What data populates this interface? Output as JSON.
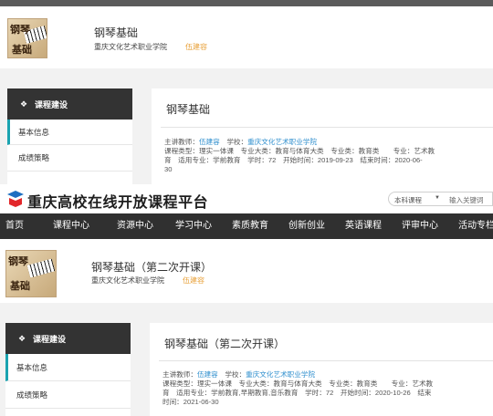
{
  "top": {
    "course_title": "钢琴基础",
    "school": "重庆文化艺术职业学院",
    "teacher": "伍建容",
    "thumb_text_1": "钢琴",
    "thumb_text_2": "基础",
    "sidebar": {
      "header": "课程建设",
      "items": [
        "基本信息",
        "成绩策略"
      ]
    },
    "panel": {
      "title": "钢琴基础",
      "teacher_label": "主讲教师：",
      "teacher": "伍建容",
      "school_label": "学校：",
      "school": "重庆文化艺术职业学院",
      "line2": "课程类型：理实一体课　专业大类：教育与体育大类　专业类：教育类　　专业：艺术教",
      "line3": "育　适用专业：学前教育　学时：72　开始时间：2019-09-23　结束时间：2020-06-",
      "line4": "30"
    }
  },
  "site": {
    "name": "重庆高校在线开放课程平台",
    "search_select": "本科课程",
    "search_placeholder": "输入关键词",
    "nav": [
      "首页",
      "课程中心",
      "资源中心",
      "学习中心",
      "素质教育",
      "创新创业",
      "英语课程",
      "评审中心",
      "活动专栏"
    ]
  },
  "bottom": {
    "course_title": "钢琴基础（第二次开课）",
    "school": "重庆文化艺术职业学院",
    "teacher": "伍建容",
    "thumb_text_1": "钢琴",
    "thumb_text_2": "基础",
    "sidebar": {
      "header": "课程建设",
      "items": [
        "基本信息",
        "成绩策略"
      ]
    },
    "panel": {
      "title": "钢琴基础（第二次开课）",
      "teacher_label": "主讲教师：",
      "teacher": "伍建容",
      "school_label": "学校：",
      "school": "重庆文化艺术职业学院",
      "line2": "课程类型：理实一体课　专业大类：教育与体育大类　专业类：教育类　　专业：艺术教",
      "line3": "育　适用专业：学前教育,早期教育,音乐教育　学时：72　开始时间：2020-10-26　结束",
      "line4": "时间：2021-06-30"
    }
  }
}
